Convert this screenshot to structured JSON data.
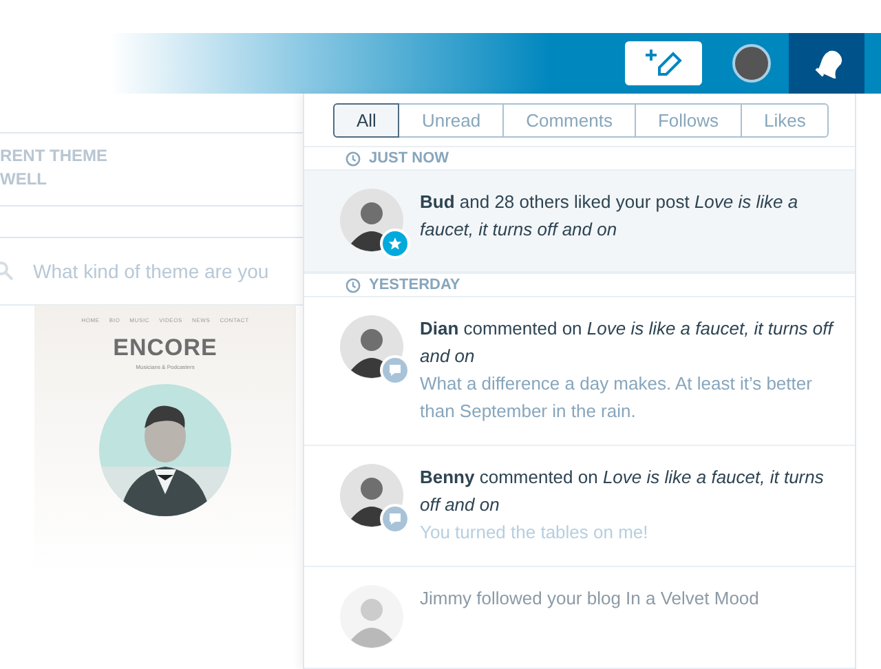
{
  "toolbar": {
    "buttons": [
      {
        "kind": "write",
        "selected": false
      },
      {
        "kind": "avatar",
        "selected": false
      },
      {
        "kind": "notifications",
        "selected": true
      }
    ]
  },
  "theme_panel": {
    "label_lines": [
      "RENT THEME",
      "WELL"
    ],
    "search": {
      "placeholder": "What kind of theme are you"
    },
    "preview": {
      "nav": [
        "HOME",
        "BIO",
        "MUSIC",
        "VIDEOS",
        "NEWS",
        "CONTACT"
      ],
      "title": "ENCORE",
      "subtitle": "Musicians & Podcasters"
    }
  },
  "notifications": {
    "tabs": [
      {
        "label": "All",
        "selected": true
      },
      {
        "label": "Unread",
        "selected": false
      },
      {
        "label": "Comments",
        "selected": false
      },
      {
        "label": "Follows",
        "selected": false
      },
      {
        "label": "Likes",
        "selected": false
      }
    ],
    "groups": [
      {
        "heading": "JUST NOW",
        "items": [
          {
            "kind": "like",
            "unread": true,
            "dimmed": false,
            "text": "**Bud** and 28 others liked your post *Love is like a faucet, it turns off and on*"
          }
        ]
      },
      {
        "heading": "YESTERDAY",
        "items": [
          {
            "kind": "comment",
            "unread": false,
            "dimmed": false,
            "text": "**Dian** commented on *Love is like a faucet, it turns off and on*",
            "excerpt": "What a difference a day makes. At least it’s better than September in the rain.",
            "excerpt_faded": false
          },
          {
            "kind": "comment",
            "unread": false,
            "dimmed": false,
            "text": "**Benny** commented on *Love is like a faucet, it turns off and on*",
            "excerpt": "You turned the tables on me!",
            "excerpt_faded": true
          },
          {
            "kind": "follow",
            "unread": false,
            "dimmed": true,
            "text": "Jimmy followed your blog In a Velvet Mood"
          }
        ]
      }
    ]
  }
}
